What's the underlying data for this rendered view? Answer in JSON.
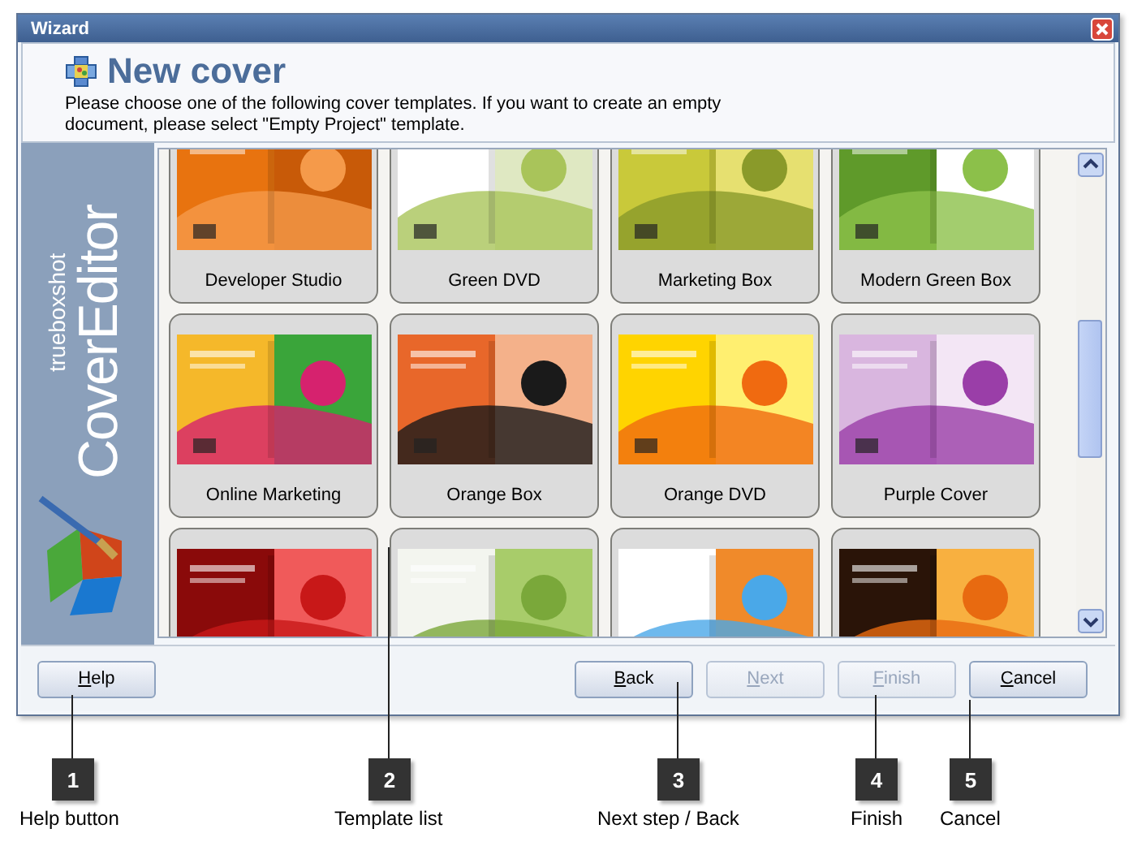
{
  "window": {
    "title": "Wizard"
  },
  "header": {
    "title": "New cover",
    "description": "Please choose one of the following cover templates. If you want to create an empty document, please select \"Empty Project\" template."
  },
  "sidebar": {
    "logo_small": "trueboxshot",
    "logo_large": "CoverEditor"
  },
  "templates": [
    {
      "kind": "picture",
      "label": "Developer Studio"
    },
    {
      "kind": "picture",
      "label": "Green DVD"
    },
    {
      "kind": "picture",
      "label": "Marketing Box"
    },
    {
      "kind": "picture",
      "label": "Modern Green Box"
    },
    {
      "kind": "picture",
      "label": "Online Marketing"
    },
    {
      "kind": "picture",
      "label": "Orange Box"
    },
    {
      "kind": "picture",
      "label": "Orange DVD"
    },
    {
      "kind": "picture",
      "label": "Purple Cover"
    },
    {
      "kind": "picture"
    },
    {
      "kind": "picture"
    },
    {
      "kind": "picture"
    },
    {
      "kind": "picture"
    }
  ],
  "buttons": [
    {
      "label": "Help",
      "disabled": false
    },
    {
      "label": "Back",
      "disabled": false
    },
    {
      "label": "Next",
      "disabled": true
    },
    {
      "label": "Finish",
      "disabled": true
    },
    {
      "label": "Cancel",
      "disabled": false
    }
  ],
  "callouts": [
    {
      "number": "1",
      "label": "Help button"
    },
    {
      "number": "2",
      "label": "Template list"
    },
    {
      "number": "3",
      "label": "Next step / Back"
    },
    {
      "number": "4",
      "label": "Finish"
    },
    {
      "number": "5",
      "label": "Cancel"
    }
  ]
}
